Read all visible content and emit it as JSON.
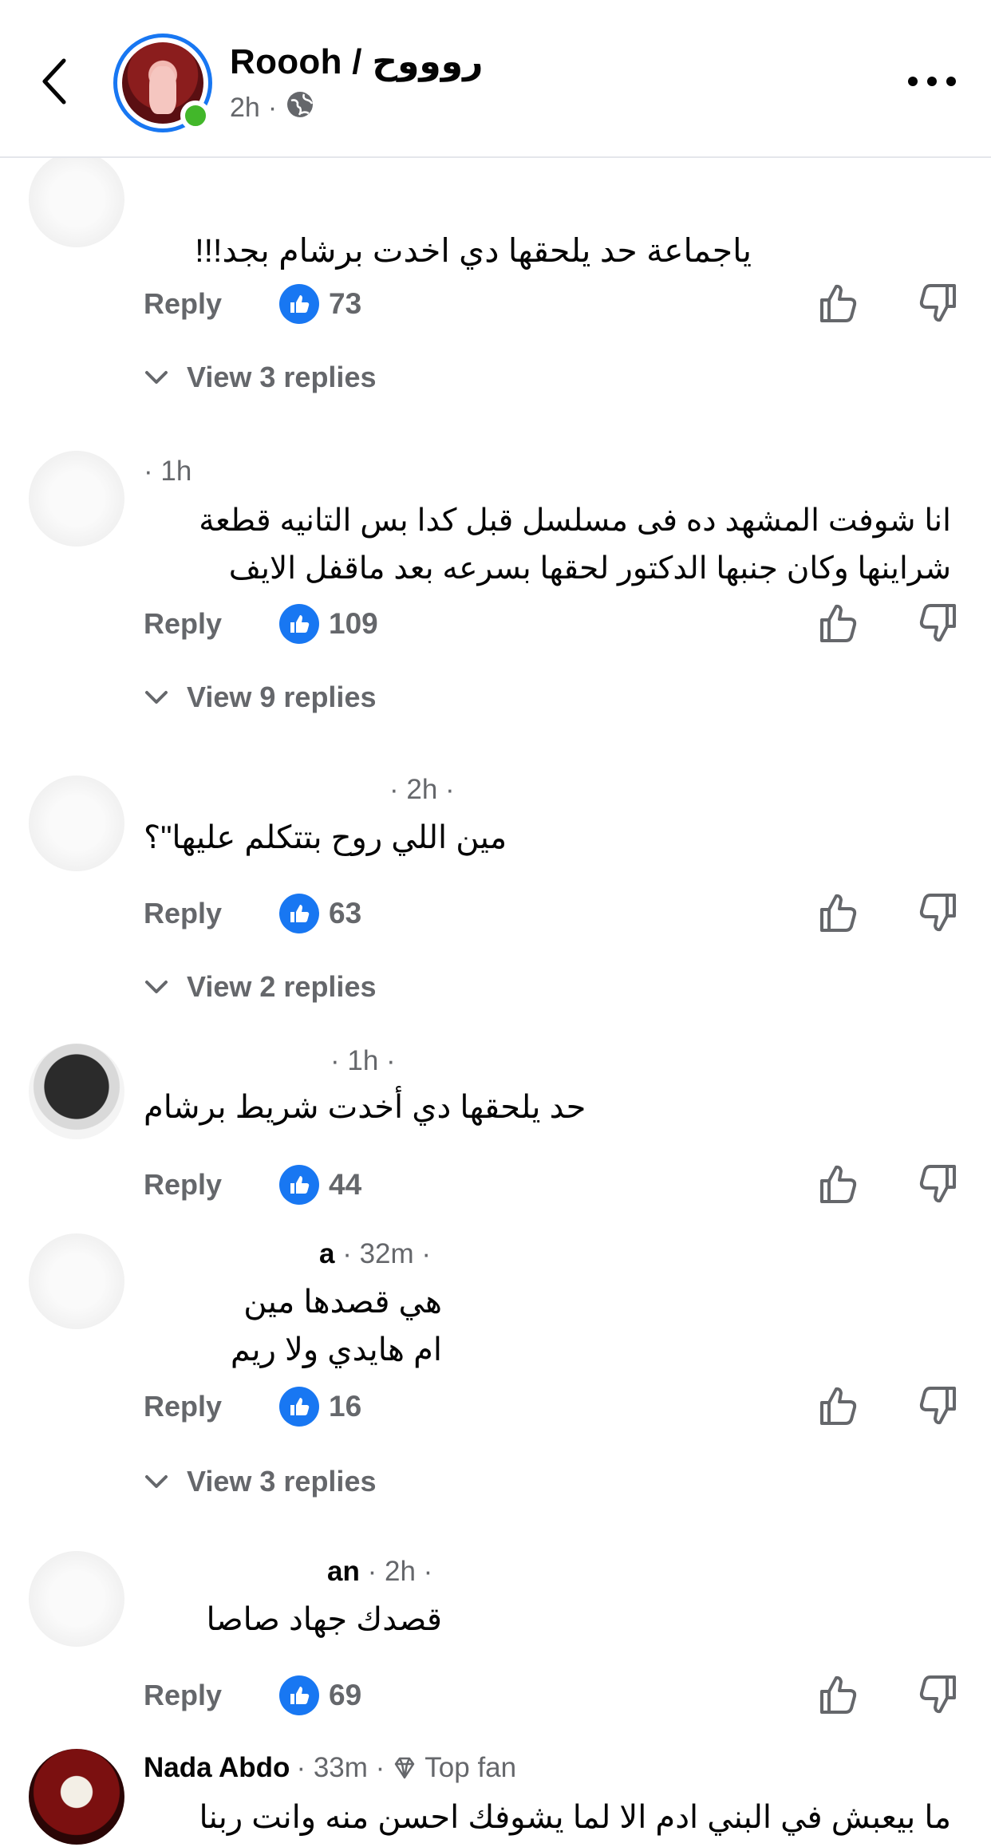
{
  "header": {
    "title": "Roooh / روووح",
    "time": "2h",
    "dot": "·"
  },
  "comments": [
    {
      "name_visible": "",
      "time": "",
      "text_lines": [
        "ياجماعة حد يلحقها دي اخدت برشام بجد!!!"
      ],
      "reply_label": "Reply",
      "likes": "73",
      "view_replies": "View 3 replies"
    },
    {
      "name_visible": "",
      "time": "· 1h",
      "text_lines": [
        "انا شوفت المشهد ده فى مسلسل قبل كدا بس التانيه قطعة",
        "شراينها وكان جنبها الدكتور لحقها بسرعه بعد ماقفل الايف"
      ],
      "reply_label": "Reply",
      "likes": "109",
      "view_replies": "View 9 replies"
    },
    {
      "name_visible": "",
      "time": "· 2h ·",
      "text_lines": [
        "مين اللي روح بتتكلم عليها\"؟"
      ],
      "reply_label": "Reply",
      "likes": "63",
      "view_replies": "View 2 replies"
    },
    {
      "name_visible": "",
      "time": "· 1h ·",
      "text_lines": [
        "حد يلحقها دي أخدت شريط برشام"
      ],
      "reply_label": "Reply",
      "likes": "44",
      "view_replies": ""
    },
    {
      "name_visible": "a",
      "time": "· 32m ·",
      "text_lines": [
        "هي قصدها مين",
        "ام هايدي ولا ريم"
      ],
      "reply_label": "Reply",
      "likes": "16",
      "view_replies": "View 3 replies"
    },
    {
      "name_visible": "an",
      "time": "· 2h ·",
      "text_lines": [
        "قصدك جهاد صاصا"
      ],
      "reply_label": "Reply",
      "likes": "69",
      "view_replies": ""
    },
    {
      "name_visible": "Nada Abdo",
      "time": "· 33m ·",
      "badge": "Top fan",
      "text_lines": [
        "ما بيعبش في البني ادم الا لما يشوفك احسن منه وانت ربنا"
      ],
      "reply_label": "",
      "likes": "",
      "view_replies": ""
    }
  ],
  "icons": {
    "back": "chevron-left-icon",
    "privacy": "globe-icon",
    "more": "more-dots-icon",
    "like_badge": "thumbs-up-icon",
    "upvote": "thumbs-up-outline-icon",
    "downvote": "thumbs-down-outline-icon",
    "expand": "chevron-down-icon",
    "top_fan": "diamond-icon"
  },
  "colors": {
    "accent": "#1877f2",
    "secondary_text": "#65676b",
    "online": "#42b72a"
  }
}
